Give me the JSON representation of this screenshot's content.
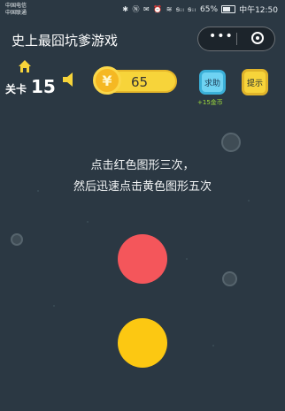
{
  "status_bar": {
    "carrier1": "中国电信",
    "carrier2": "中国联通",
    "icons": "✱ Ⓝ ✉ ⏰ ≋ ᵴᵢₗ ᵴᵢₗ",
    "battery": "65%",
    "time": "中午12:50"
  },
  "header": {
    "title": "史上最囧坑爹游戏",
    "more_label": "•••"
  },
  "hud": {
    "level_label": "关卡",
    "level_number": "15",
    "coin_symbol": "¥",
    "coins": "65",
    "help_label": "求助",
    "help_reward": "+15金币",
    "hint_label": "提示"
  },
  "puzzle": {
    "line1": "点击红色图形三次，",
    "line2": "然后迅速点击黄色图形五次"
  },
  "colors": {
    "background": "#2b3843",
    "red_shape": "#f4565b",
    "yellow_shape": "#fcc812",
    "coin": "#f7d43a",
    "help_button": "#6fd3f2",
    "reward_text": "#9fdc3c"
  },
  "icons": {
    "home": "home-icon",
    "sound": "speaker-icon",
    "coin": "coin-icon",
    "more": "more-icon",
    "close": "close-icon"
  }
}
